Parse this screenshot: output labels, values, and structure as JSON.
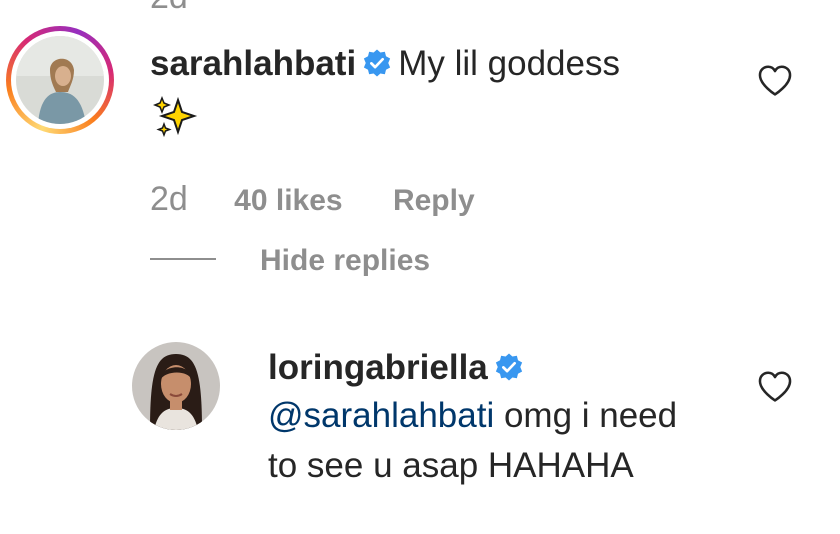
{
  "partial_top_text": "2d",
  "comment": {
    "username": "sarahlahbati",
    "verified": true,
    "text": "My lil goddess",
    "emoji": "sparkles",
    "time": "2d",
    "likes": "40 likes",
    "reply_label": "Reply",
    "avatar": "avatar-with-story-ring"
  },
  "hide_replies_label": "Hide replies",
  "reply": {
    "username": "loringabriella",
    "verified": true,
    "mention": "@sarahlahbati",
    "text_line1": " omg i need",
    "text_line2": "to see u asap HAHAHA"
  },
  "colors": {
    "text": "#262626",
    "secondary": "#8e8e8e",
    "verified_blue": "#3897f0",
    "mention": "#00376b"
  },
  "icons": [
    "verified-badge-icon",
    "heart-icon",
    "sparkles-emoji"
  ]
}
